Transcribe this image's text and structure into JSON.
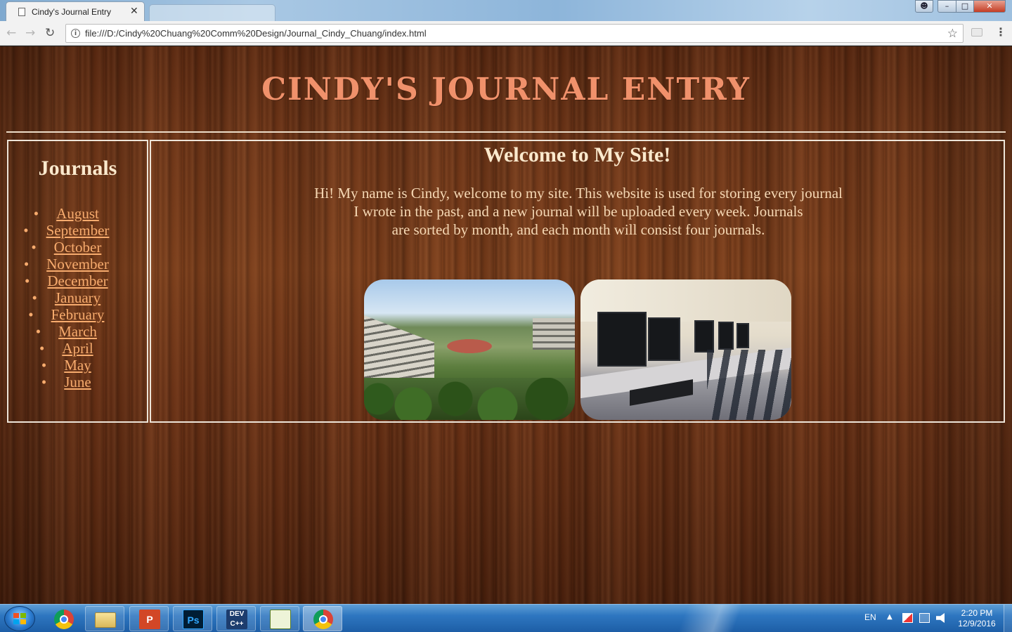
{
  "browser": {
    "tab_title": "Cindy's Journal Entry",
    "tab_close": "✕",
    "url": "file:///D:/Cindy%20Chuang%20Comm%20Design/Journal_Cindy_Chuang/index.html",
    "back_icon": "arrow-left-icon",
    "forward_icon": "arrow-right-icon",
    "reload_icon": "reload-icon",
    "bookmark_icon": "star-icon",
    "menu_icon": "kebab-menu-icon"
  },
  "page": {
    "site_title": "Cindy's Journal Entry",
    "sidebar": {
      "heading": "Journals",
      "months": [
        "August",
        "September",
        "October",
        "November",
        "December",
        "January",
        "February",
        "March",
        "April",
        "May",
        "June"
      ]
    },
    "main": {
      "heading": "Welcome to My Site!",
      "intro_lines": [
        "Hi! My name is Cindy, welcome to my site. This website is used for storing every journal",
        "I wrote in the past, and a new journal will be uploaded every week. Journals",
        "are sorted by month, and each month will consist four journals."
      ],
      "photos": [
        "campus-photo",
        "computer-lab-photo"
      ]
    },
    "colors": {
      "title": "#f0916b",
      "heading": "#fbe9cd",
      "link": "#f7ab6d",
      "text": "#f6d8b4",
      "border": "#ede4d8",
      "wood": "#6e3517"
    }
  },
  "taskbar": {
    "apps": [
      "chrome",
      "file-explorer",
      "powerpoint",
      "photoshop",
      "dev-cpp",
      "notepad",
      "chrome"
    ],
    "language": "EN",
    "time": "2:20 PM",
    "date": "12/9/2016",
    "ppt_label": "P",
    "ps_label": "Ps",
    "dev_label": "DEV C++"
  }
}
